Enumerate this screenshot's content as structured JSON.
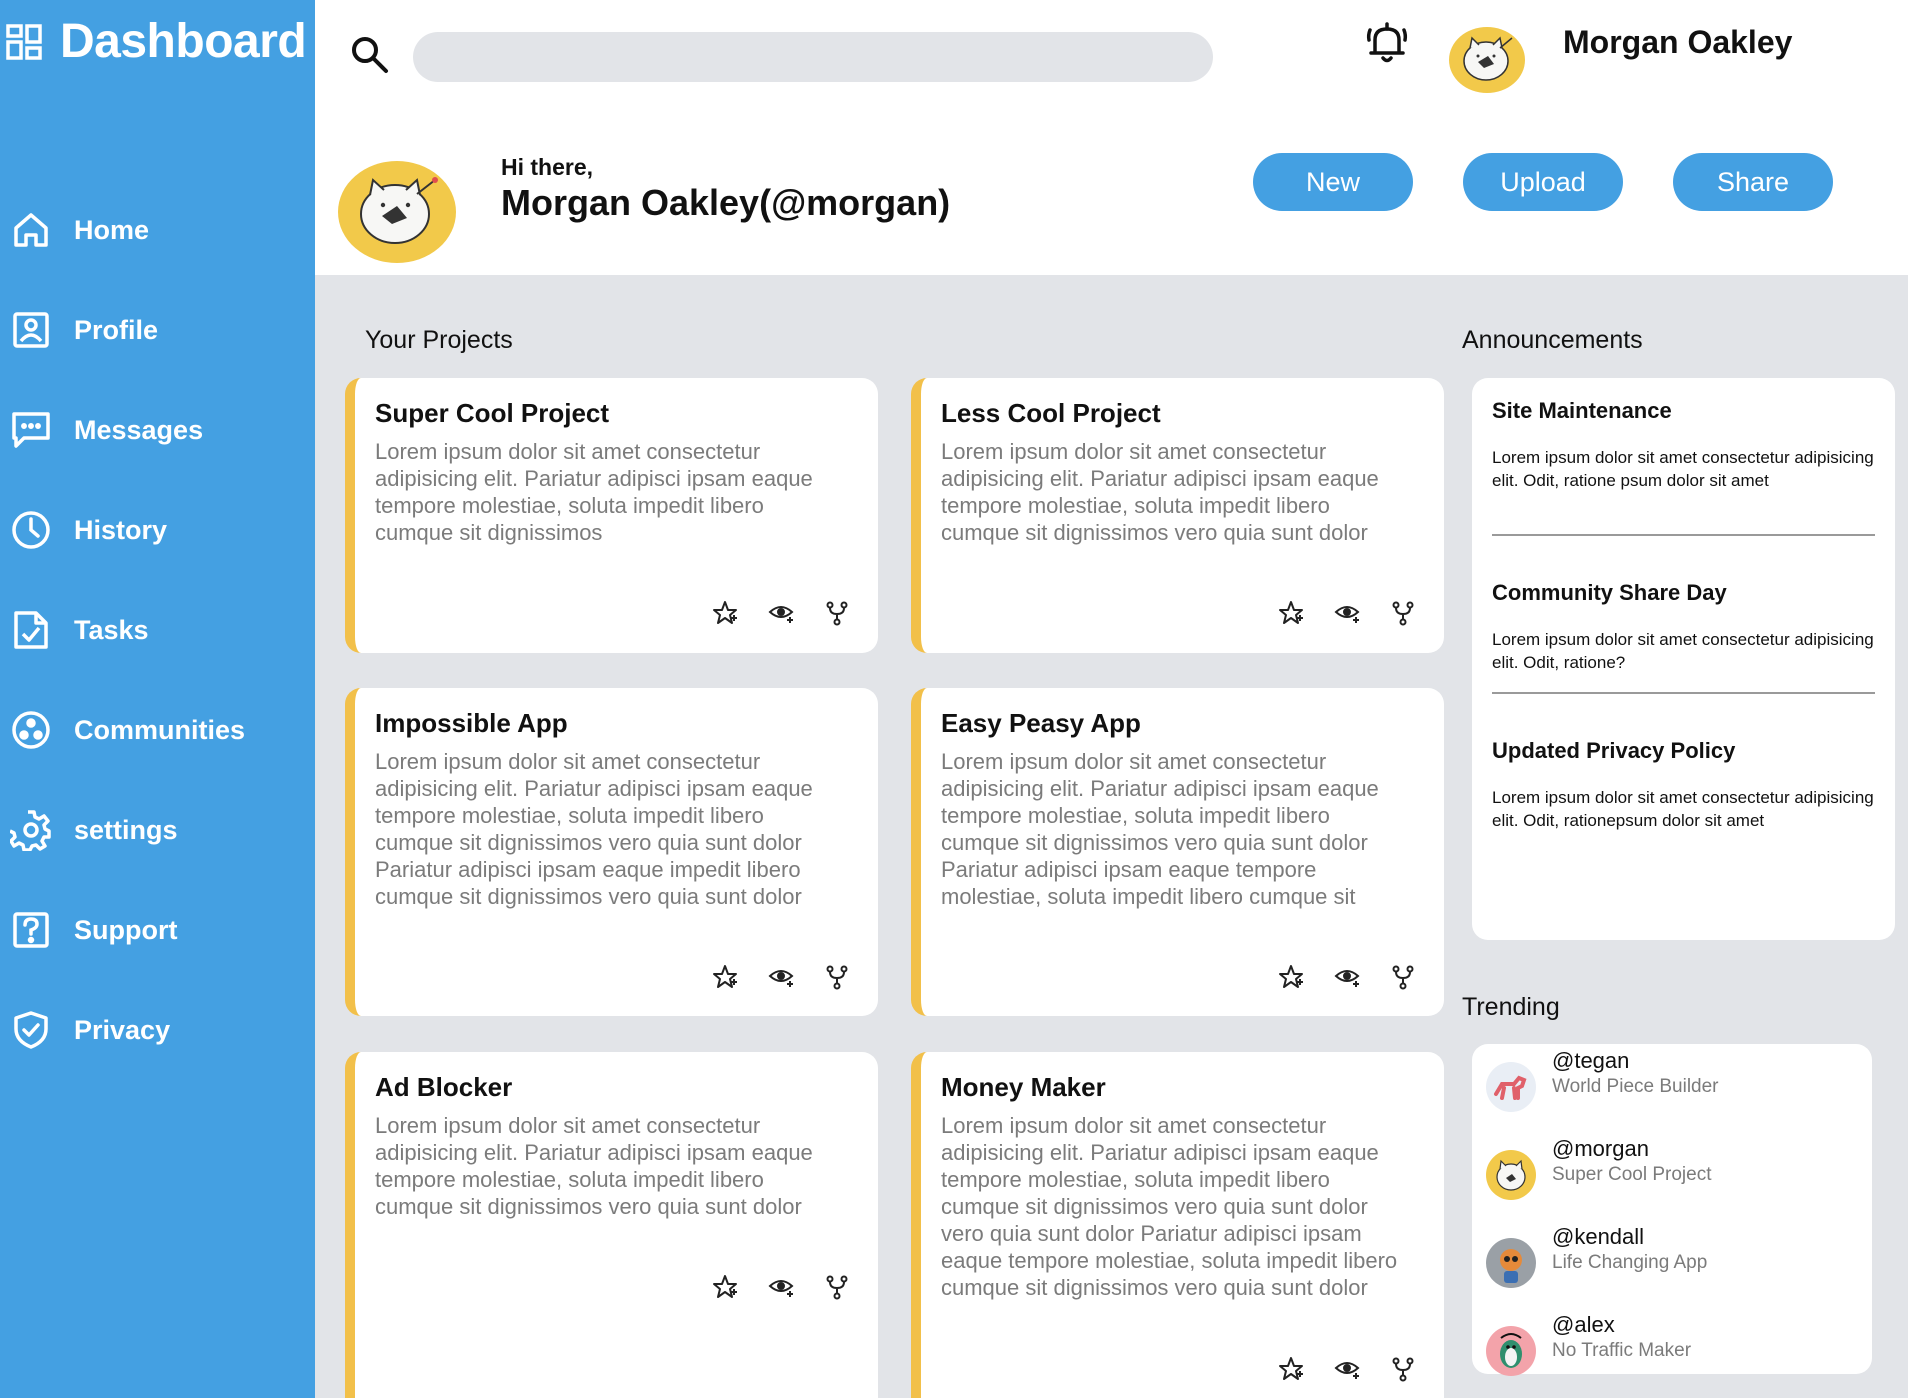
{
  "colors": {
    "accent": "#44a0e2",
    "card_border": "#f2c04a",
    "background": "#e2e4e8",
    "avatar_yellow": "#f2c94a"
  },
  "sidebar": {
    "brand": {
      "icon": "dashboard-grid-icon",
      "title": "Dashboard"
    },
    "items": [
      {
        "label": "Home",
        "icon": "home-icon"
      },
      {
        "label": "Profile",
        "icon": "profile-icon"
      },
      {
        "label": "Messages",
        "icon": "message-icon"
      },
      {
        "label": "History",
        "icon": "clock-icon"
      },
      {
        "label": "Tasks",
        "icon": "tasks-icon"
      },
      {
        "label": "Communities",
        "icon": "communities-icon"
      },
      {
        "label": "settings",
        "icon": "gear-icon"
      },
      {
        "label": "Support",
        "icon": "question-icon"
      },
      {
        "label": "Privacy",
        "icon": "shield-icon"
      }
    ]
  },
  "header": {
    "search": {
      "placeholder": "",
      "value": ""
    },
    "notifications_icon": "bell-icon",
    "username": "Morgan Oakley",
    "greeting": "Hi there,",
    "fullname": "Morgan Oakley(@morgan)",
    "buttons": {
      "new": "New",
      "upload": "Upload",
      "share": "Share"
    }
  },
  "projects": {
    "title": "Your Projects",
    "items": [
      {
        "title": "Super Cool Project",
        "desc": "Lorem ipsum dolor sit amet consectetur adipisicing elit. Pariatur adipisci ipsam eaque tempore molestiae, soluta impedit libero cumque sit dignissimos"
      },
      {
        "title": "Less Cool Project",
        "desc": "Lorem ipsum dolor sit amet consectetur adipisicing elit. Pariatur adipisci ipsam eaque tempore molestiae, soluta impedit libero cumque sit dignissimos vero quia sunt dolor"
      },
      {
        "title": "Impossible App",
        "desc": "Lorem ipsum dolor sit amet consectetur adipisicing elit. Pariatur adipisci ipsam eaque tempore molestiae, soluta impedit libero cumque sit dignissimos vero quia sunt dolor Pariatur adipisci ipsam eaque impedit libero cumque sit dignissimos vero quia sunt dolor"
      },
      {
        "title": "Easy Peasy App",
        "desc": "Lorem ipsum dolor sit amet consectetur adipisicing elit. Pariatur adipisci ipsam eaque tempore molestiae, soluta impedit libero cumque sit dignissimos vero quia sunt dolor Pariatur adipisci ipsam eaque tempore molestiae, soluta impedit libero cumque sit"
      },
      {
        "title": "Ad Blocker",
        "desc": "Lorem ipsum dolor sit amet consectetur adipisicing elit. Pariatur adipisci ipsam eaque tempore molestiae, soluta impedit libero cumque sit dignissimos vero quia sunt dolor"
      },
      {
        "title": "Money Maker",
        "desc": "Lorem ipsum dolor sit amet consectetur adipisicing elit. Pariatur adipisci ipsam eaque tempore molestiae, soluta impedit libero cumque sit dignissimos vero quia sunt dolor vero quia sunt dolor Pariatur adipisci ipsam eaque tempore molestiae, soluta impedit libero cumque sit dignissimos vero quia sunt dolor"
      }
    ],
    "action_icons": [
      "star-icon",
      "watch-icon",
      "fork-icon"
    ]
  },
  "announcements": {
    "title": "Announcements",
    "items": [
      {
        "title": "Site Maintenance",
        "body": "Lorem ipsum dolor sit amet consectetur adipisicing elit. Odit, ratione psum dolor sit amet"
      },
      {
        "title": "Community Share Day",
        "body": "Lorem ipsum dolor sit amet consectetur adipisicing elit. Odit, ratione?"
      },
      {
        "title": "Updated Privacy Policy",
        "body": "Lorem ipsum dolor sit amet consectetur adipisicing elit. Odit, rationepsum dolor sit amet"
      }
    ]
  },
  "trending": {
    "title": "Trending",
    "items": [
      {
        "handle": "@tegan",
        "project": "World Piece Builder",
        "avatar": "dog-avatar"
      },
      {
        "handle": "@morgan",
        "project": "Super Cool Project",
        "avatar": "cat-avatar"
      },
      {
        "handle": "@kendall",
        "project": "Life Changing App",
        "avatar": "fox-avatar"
      },
      {
        "handle": "@alex",
        "project": "No Traffic Maker",
        "avatar": "penguin-avatar"
      }
    ]
  }
}
